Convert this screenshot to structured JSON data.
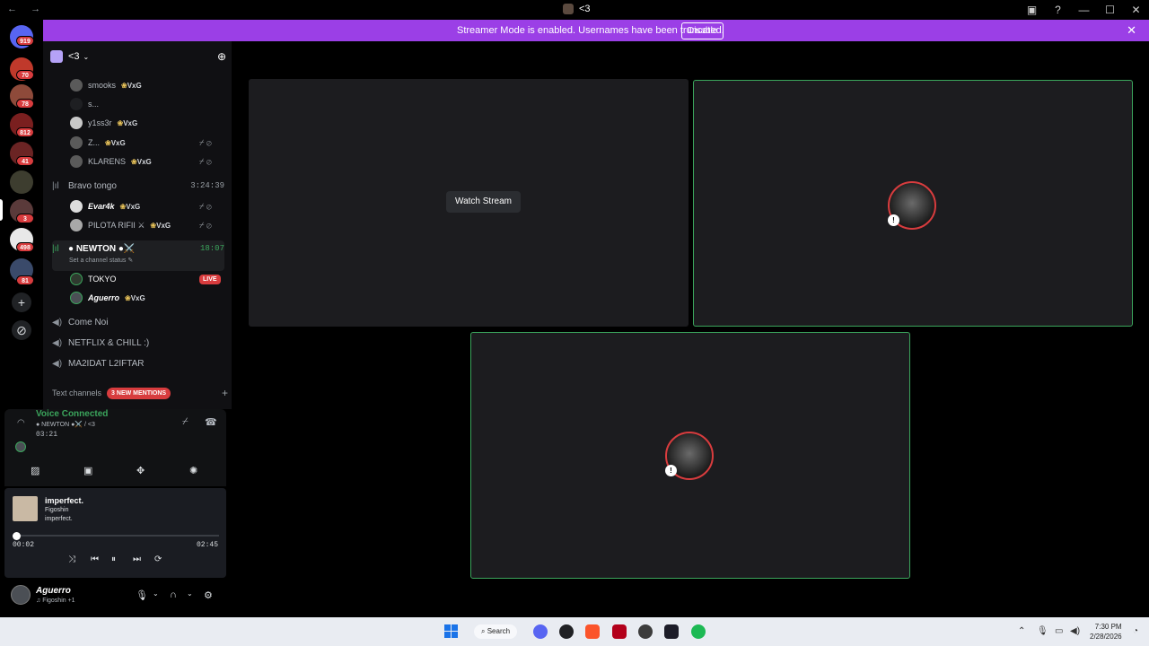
{
  "window": {
    "title": "<3",
    "back": "←",
    "forward": "→"
  },
  "banner": {
    "message": "Streamer Mode is enabled. Usernames have been truncated.",
    "disable": "Disable"
  },
  "rail": {
    "badges": [
      "919",
      "70",
      "78",
      "812",
      "41",
      "3",
      "498",
      "81"
    ]
  },
  "server": {
    "name": "<3"
  },
  "voice_users_top": [
    {
      "name": "smooks",
      "tag": "VxG"
    },
    {
      "name": "s...",
      "tag": ""
    },
    {
      "name": "y1ss3r",
      "tag": "VxG"
    },
    {
      "name": "Z...",
      "tag": "VxG"
    },
    {
      "name": "KLARENS",
      "tag": "VxG"
    }
  ],
  "channels": {
    "bravo": {
      "name": "Bravo tongo",
      "timer": "3:24:39"
    },
    "bravo_users": [
      {
        "name": "Evar4k",
        "tag": "VxG"
      },
      {
        "name": "PILOTA RIFII ⚔",
        "tag": "VxG"
      }
    ],
    "newton": {
      "name": "● NEWTON ●⚔️",
      "timer": "18:07",
      "status": "Set a channel status ✎"
    },
    "newton_users": [
      {
        "name": "TOKYO",
        "tag": "",
        "live": "LIVE"
      },
      {
        "name": "Aguerro",
        "tag": "VxG"
      }
    ],
    "others": [
      "Come Noi",
      "NETFLIX & CHILL :)",
      "MA2IDAT L2IFTAR"
    ],
    "text_header": "Text channels",
    "mentions": "3 NEW MENTIONS"
  },
  "voice": {
    "status": "Voice Connected",
    "channel": "● NEWTON ●⚔️ / <3",
    "time": "03:21"
  },
  "player": {
    "song": "imperfect.",
    "artist": "Figoshin",
    "album": "imperfect.",
    "elapsed": "00:02",
    "duration": "02:45",
    "progress": 0.012
  },
  "user": {
    "name": "Aguerro",
    "activity": "♫ Figoshin +1"
  },
  "stage": {
    "watch": "Watch Stream"
  },
  "taskbar": {
    "search": "Search",
    "time": "7:30 PM",
    "date": "2/28/2026"
  }
}
